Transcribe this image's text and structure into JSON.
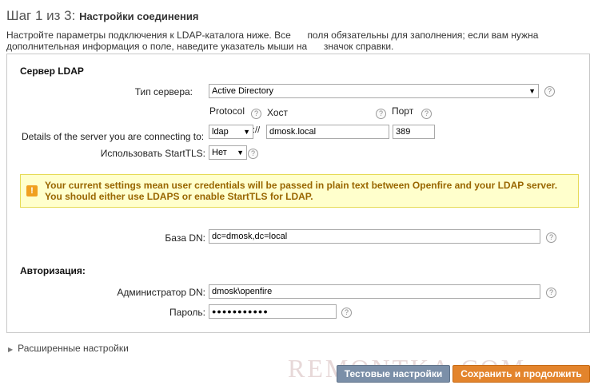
{
  "header": {
    "step": "Шаг 1 из 3:",
    "title": "Настройки соединения",
    "intro_1": "Настройте параметры подключения к LDAP-каталога ниже. Все",
    "intro_2": "поля обязательны для заполнения; если вам нужна",
    "intro_3": "дополнительная информация о поле, наведите указатель мыши на",
    "intro_4": "значок справки."
  },
  "server_section": {
    "heading": "Сервер LDAP",
    "server_type_label": "Тип сервера:",
    "server_type_value": "Active Directory",
    "protocol_label": "Protocol",
    "host_label": "Хост",
    "port_label": "Порт",
    "details_label": "Details of the server you are connecting to:",
    "protocol_value": "ldap",
    "separator": "://",
    "host_value": "dmosk.local",
    "port_value": "389",
    "starttls_label": "Использовать StartTLS:",
    "starttls_value": "Нет"
  },
  "warning": {
    "icon": "!",
    "text_1": "Your current settings mean user credentials will be passed in plain text between Openfire and your LDAP server.",
    "text_2": "You should either use LDAPS or enable StartTLS for LDAP."
  },
  "base_dn": {
    "label": "База DN:",
    "value": "dc=dmosk,dc=local"
  },
  "auth_section": {
    "heading": "Авторизация:",
    "admin_label": "Администратор DN:",
    "admin_value": "dmosk\\openfire",
    "password_label": "Пароль:",
    "password_value": "●●●●●●●●●●●"
  },
  "advanced": {
    "label": "Расширенные настройки"
  },
  "buttons": {
    "test": "Тестовые настройки",
    "save": "Сохранить и продолжить"
  },
  "help_glyph": "?",
  "watermark": "REMONTKA.COM",
  "colors": {
    "warning_bg": "#ffffcc",
    "warning_text": "#996600",
    "save_button": "#e3842c",
    "test_button": "#7b8fa8"
  }
}
